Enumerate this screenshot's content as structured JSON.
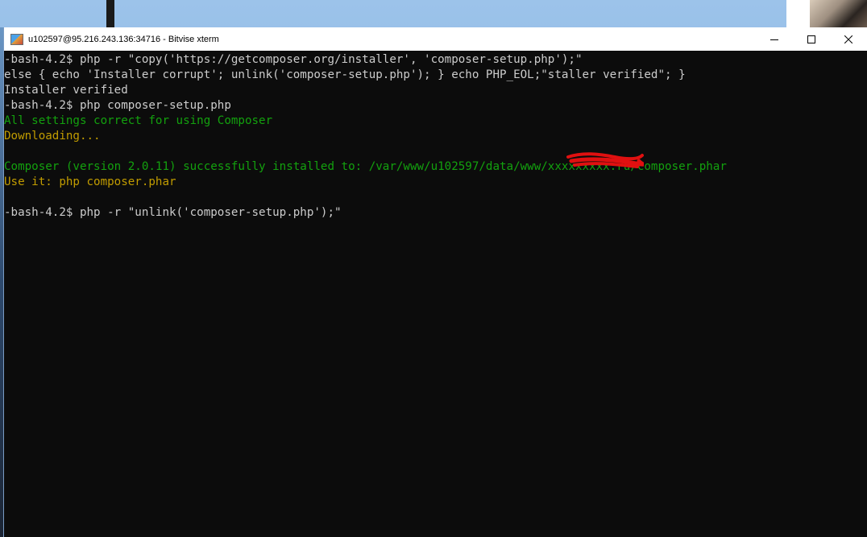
{
  "window": {
    "title": "u102597@95.216.243.136:34716 - Bitvise xterm"
  },
  "colors": {
    "terminal_bg": "#0c0c0c",
    "default_text": "#cccccc",
    "green_text": "#13a10e",
    "yellow_text": "#c19c00",
    "redaction": "#e01010"
  },
  "icons": {
    "app": "bitvise-xterm-icon",
    "minimize": "minimize-icon",
    "maximize": "maximize-icon",
    "close": "close-icon"
  },
  "terminal": {
    "lines": [
      {
        "text": "-bash-4.2$ php -r \"copy('https://getcomposer.org/installer', 'composer-setup.php');\"",
        "color": "default"
      },
      {
        "text": "else { echo 'Installer corrupt'; unlink('composer-setup.php'); } echo PHP_EOL;\"staller verified\"; }",
        "color": "default"
      },
      {
        "text": "Installer verified",
        "color": "default"
      },
      {
        "text": "-bash-4.2$ php composer-setup.php",
        "color": "default"
      },
      {
        "text": "All settings correct for using Composer",
        "color": "green"
      },
      {
        "text": "Downloading...",
        "color": "yellow"
      },
      {
        "text": "",
        "color": "default"
      },
      {
        "text": "Composer (version 2.0.11) successfully installed to: /var/www/u102597/data/www/xxxxxxxxx.ru/composer.phar",
        "color": "green"
      },
      {
        "text": "Use it: php composer.phar",
        "color": "yellow"
      },
      {
        "text": "",
        "color": "default"
      },
      {
        "text": "-bash-4.2$ php -r \"unlink('composer-setup.php');\"",
        "color": "default"
      }
    ]
  }
}
